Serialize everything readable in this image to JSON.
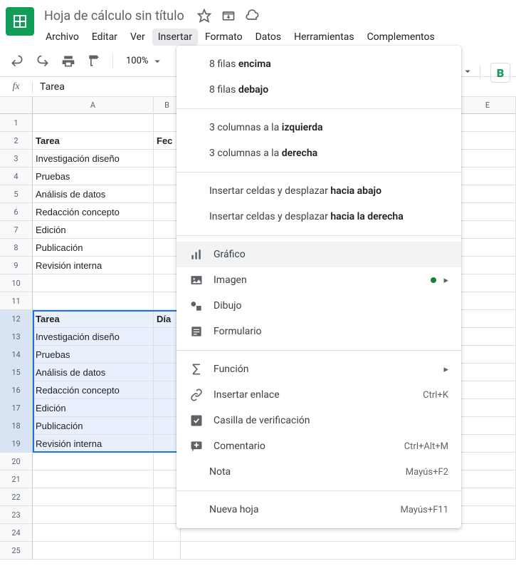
{
  "doc": {
    "title": "Hoja de cálculo sin título"
  },
  "menus": [
    "Archivo",
    "Editar",
    "Ver",
    "Insertar",
    "Formato",
    "Datos",
    "Herramientas",
    "Complementos"
  ],
  "active_menu": 3,
  "toolbar": {
    "zoom": "100%",
    "bold": "B"
  },
  "fx": {
    "value": "Tarea"
  },
  "columns": [
    "A",
    "B",
    "E"
  ],
  "rows": {
    "2": {
      "A": "Tarea",
      "B": "Fec",
      "bold": true
    },
    "3": {
      "A": "Investigación diseño"
    },
    "4": {
      "A": "Pruebas"
    },
    "5": {
      "A": "Análisis de datos"
    },
    "6": {
      "A": "Redacción concepto"
    },
    "7": {
      "A": "Edición"
    },
    "8": {
      "A": "Publicación"
    },
    "9": {
      "A": "Revisión interna"
    },
    "12": {
      "A": "Tarea",
      "B": "Día",
      "bold": true,
      "sel": true
    },
    "13": {
      "A": "Investigación diseño",
      "sel": true
    },
    "14": {
      "A": "Pruebas",
      "sel": true
    },
    "15": {
      "A": "Análisis de datos",
      "sel": true
    },
    "16": {
      "A": "Redacción concepto",
      "sel": true
    },
    "17": {
      "A": "Edición",
      "sel": true
    },
    "18": {
      "A": "Publicación",
      "sel": true
    },
    "19": {
      "A": "Revisión interna",
      "sel": true
    }
  },
  "row_count": 25,
  "dropdown": {
    "groups": [
      [
        {
          "label_pre": "8 filas ",
          "label_bold": "encima",
          "noicon": true
        },
        {
          "label_pre": "8 filas ",
          "label_bold": "debajo",
          "noicon": true
        }
      ],
      [
        {
          "label_pre": "3 columnas a la ",
          "label_bold": "izquierda",
          "noicon": true
        },
        {
          "label_pre": "3 columnas a la ",
          "label_bold": "derecha",
          "noicon": true
        }
      ],
      [
        {
          "label_pre": "Insertar celdas y desplazar ",
          "label_bold": "hacia abajo",
          "noicon": true
        },
        {
          "label_pre": "Insertar celdas y desplazar ",
          "label_bold": "hacia la derecha",
          "noicon": true
        }
      ],
      [
        {
          "icon": "chart",
          "label": "Gráfico",
          "hover": true
        },
        {
          "icon": "image",
          "label": "Imagen",
          "dot": true,
          "submenu": true
        },
        {
          "icon": "drawing",
          "label": "Dibujo"
        },
        {
          "icon": "form",
          "label": "Formulario"
        }
      ],
      [
        {
          "icon": "sigma",
          "label": "Función",
          "submenu": true
        },
        {
          "icon": "link",
          "label": "Insertar enlace",
          "shortcut": "Ctrl+K"
        },
        {
          "icon": "checkbox",
          "label": "Casilla de verificación"
        },
        {
          "icon": "comment",
          "label": "Comentario",
          "shortcut": "Ctrl+Alt+M"
        },
        {
          "label": "Nota",
          "shortcut": "Mayús+F2",
          "noicon": true
        }
      ],
      [
        {
          "label": "Nueva hoja",
          "shortcut": "Mayús+F11",
          "noicon": true
        }
      ]
    ]
  }
}
